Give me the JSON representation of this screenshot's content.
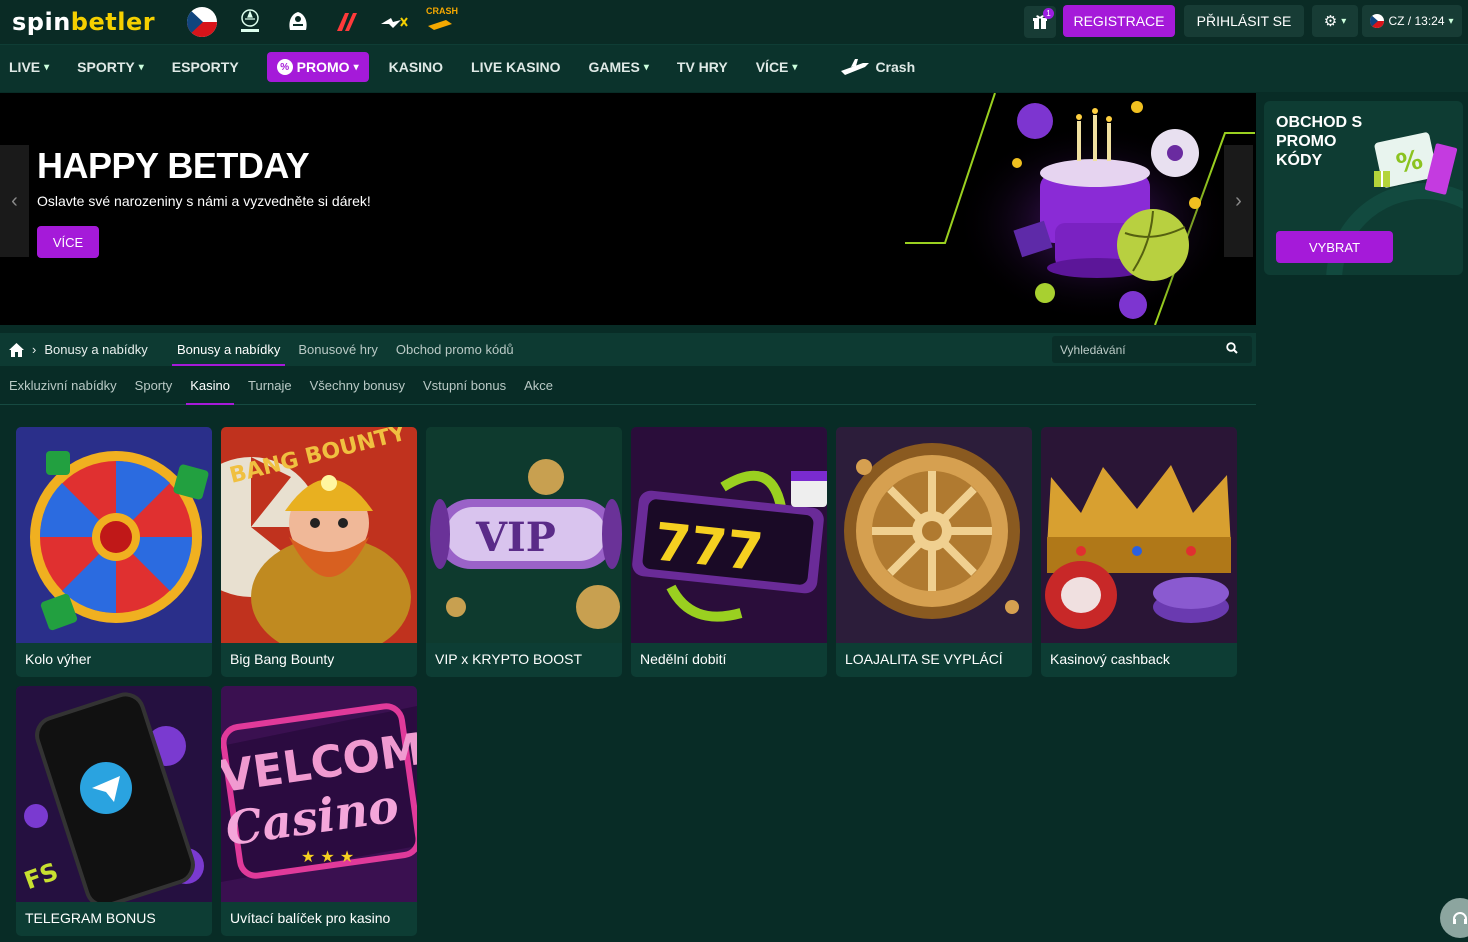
{
  "header": {
    "logo": {
      "part1": "spin",
      "part2": "betler"
    },
    "top_links": [
      {
        "name": "cz-flag-icon"
      },
      {
        "name": "champions-league-icon",
        "caption": "UEFA CHAMPIONS LEAGUE"
      },
      {
        "name": "premier-league-icon"
      },
      {
        "name": "laliga-icon"
      },
      {
        "name": "betx-icon"
      },
      {
        "name": "crash-game-icon",
        "caption": "CRASH"
      }
    ],
    "gift_badge": "1",
    "register_label": "REGISTRACE",
    "login_label": "PŘIHLÁSIT SE",
    "language_label": "CZ / 13:24"
  },
  "nav": {
    "items": [
      {
        "label": "LIVE",
        "dropdown": true
      },
      {
        "label": "SPORTY",
        "dropdown": true
      },
      {
        "label": "ESPORTY",
        "dropdown": false
      },
      {
        "label": "PROMO",
        "dropdown": true
      },
      {
        "label": "KASINO",
        "dropdown": false
      },
      {
        "label": "LIVE KASINO",
        "dropdown": false
      },
      {
        "label": "GAMES",
        "dropdown": true
      },
      {
        "label": "TV HRY",
        "dropdown": false
      },
      {
        "label": "VÍCE",
        "dropdown": true
      },
      {
        "label": "Crash",
        "dropdown": false
      }
    ]
  },
  "hero": {
    "title": "HAPPY BETDAY",
    "subtitle": "Oslavte své narozeniny s námi a vyzvedněte si dárek!",
    "button": "VÍCE"
  },
  "promo_card": {
    "title": "OBCHOD S PROMO KÓDY",
    "button": "VYBRAT"
  },
  "breadcrumb": {
    "current": "Bonusy a nabídky",
    "tabs": [
      "Bonusy a nabídky",
      "Bonusové hry",
      "Obchod promo kódů"
    ],
    "active_tab": 0
  },
  "search": {
    "placeholder": "Vyhledávání"
  },
  "subtabs": {
    "items": [
      "Exkluzivní nabídky",
      "Sporty",
      "Kasino",
      "Turnaje",
      "Všechny bonusy",
      "Vstupní bonus",
      "Akce"
    ],
    "active": 2
  },
  "cards": [
    {
      "title": "Kolo výher"
    },
    {
      "title": "Big Bang Bounty"
    },
    {
      "title": "VIP x KRYPTO BOOST"
    },
    {
      "title": "Nedělní dobití"
    },
    {
      "title": "LOAJALITA SE VYPLÁCÍ"
    },
    {
      "title": "Kasinový cashback"
    },
    {
      "title": "TELEGRAM BONUS"
    },
    {
      "title": "Uvítací balíček pro kasino"
    }
  ],
  "card_art_text": {
    "bang": "BANG BOUNTY",
    "vip": "VIP",
    "sevens": "777",
    "welcome": "VELCOM",
    "casino": "Casino",
    "fs": "FS"
  },
  "colors": {
    "accent": "#a51ad9",
    "background": "#082c26",
    "header": "#0a2b25",
    "brand_yellow": "#f5d000"
  }
}
